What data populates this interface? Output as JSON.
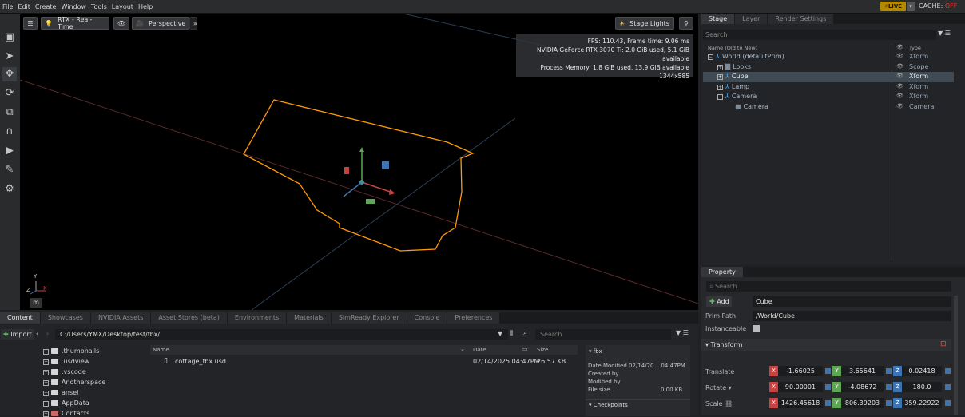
{
  "menu": [
    "File",
    "Edit",
    "Create",
    "Window",
    "Tools",
    "Layout",
    "Help"
  ],
  "live": "LIVE",
  "cache": {
    "label": "CACHE:",
    "state": "OFF"
  },
  "viewport": {
    "renderer": "RTX - Real-Time",
    "camera": "Perspective",
    "lights": "Stage Lights",
    "stats": [
      "FPS: 110.43, Frame time: 9.06 ms",
      "NVIDIA GeForce RTX 3070 Ti: 2.0 GiB used, 5.1 GiB available",
      "Process Memory: 1.8 GiB used, 13.9 GiB available",
      "1344x585"
    ],
    "axis_y": "Y",
    "axis_z": "Z",
    "axis_x": "X",
    "unit_key": "m"
  },
  "stage": {
    "tabs": [
      "Stage",
      "Layer",
      "Render Settings"
    ],
    "search_placeholder": "Search",
    "col_name": "Name (Old to New)",
    "col_type": "Type",
    "rows": [
      {
        "label": "World (defaultPrim)",
        "type": "Xform"
      },
      {
        "label": "Looks",
        "type": "Scope"
      },
      {
        "label": "Cube",
        "type": "Xform"
      },
      {
        "label": "Lamp",
        "type": "Xform"
      },
      {
        "label": "Camera",
        "type": "Xform"
      },
      {
        "label": "Camera",
        "type": "Camera"
      }
    ]
  },
  "property": {
    "tab": "Property",
    "search_placeholder": "Search",
    "add_label": "Add",
    "prim_name": "Cube",
    "prim_path_label": "Prim Path",
    "prim_path": "/World/Cube",
    "instanceable_label": "Instanceable",
    "transform_label": "Transform",
    "translate_label": "Translate",
    "rotate_label": "Rotate",
    "scale_label": "Scale",
    "translate": [
      "-1.66025",
      "3.65641",
      "0.02418"
    ],
    "rotate": [
      "90.00001",
      "-4.08672",
      "180.0"
    ],
    "scale": [
      "1426.45618",
      "806.39203",
      "359.22922"
    ],
    "x": "X",
    "y": "Y",
    "z": "Z"
  },
  "content": {
    "tabs": [
      "Content",
      "Showcases",
      "NVIDIA Assets",
      "Asset Stores (beta)",
      "Environments",
      "Materials",
      "SimReady Explorer",
      "Console",
      "Preferences"
    ],
    "import_label": "Import",
    "path": "C:/Users/YMX/Desktop/test/fbx/",
    "search_placeholder": "Search",
    "tree": [
      ".thumbnails",
      ".usdview",
      ".vscode",
      "Anotherspace",
      "ansel",
      "AppData",
      "Contacts"
    ],
    "col_name": "Name",
    "col_date": "Date",
    "col_size": "Size",
    "file": {
      "name": "cottage_fbx.usd",
      "date": "02/14/2025 04:47PM",
      "size": "26.57 KB"
    },
    "detail": {
      "folder": "fbx",
      "date_modified": "Date Modified  02/14/20... 04:47PM",
      "created_by": "Created by",
      "modified_by": "Modified by",
      "file_size_label": "File size",
      "file_size": "0.00 KB",
      "checkpoints": "Checkpoints"
    }
  },
  "colors": {
    "accent": "#b58900",
    "selection": "#ff9a00",
    "xaxis": "#c94242",
    "yaxis": "#5fa555",
    "zaxis": "#3f74b3"
  }
}
